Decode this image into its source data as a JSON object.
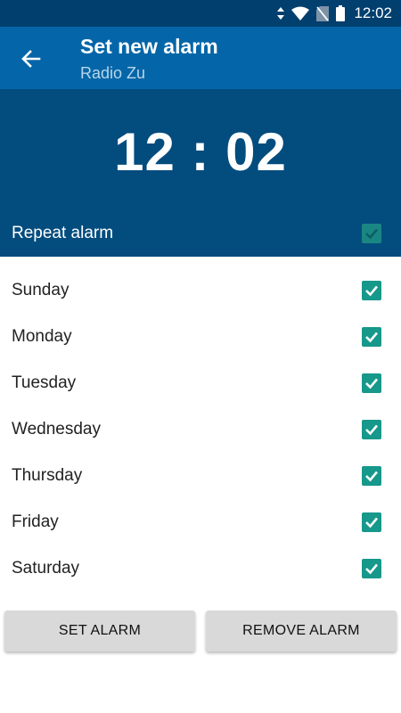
{
  "status_bar": {
    "time": "12:02",
    "icons": [
      "data-arrows-icon",
      "wifi-icon",
      "no-sim-icon",
      "battery-icon"
    ]
  },
  "app_bar": {
    "back_icon": "arrow-left-icon",
    "title": "Set new alarm",
    "subtitle": "Radio Zu"
  },
  "alarm": {
    "time": "12 : 02",
    "repeat_label": "Repeat alarm",
    "repeat_checked": true
  },
  "days": [
    {
      "label": "Sunday",
      "checked": true
    },
    {
      "label": "Monday",
      "checked": true
    },
    {
      "label": "Tuesday",
      "checked": true
    },
    {
      "label": "Wednesday",
      "checked": true
    },
    {
      "label": "Thursday",
      "checked": true
    },
    {
      "label": "Friday",
      "checked": true
    },
    {
      "label": "Saturday",
      "checked": true
    }
  ],
  "buttons": {
    "set_label": "SET ALARM",
    "remove_label": "REMOVE ALARM"
  },
  "colors": {
    "status_bar": "#003f6e",
    "app_bar": "#0466a8",
    "time_panel": "#034c7e",
    "checkbox": "#16988b",
    "button": "#d9d9d9"
  }
}
